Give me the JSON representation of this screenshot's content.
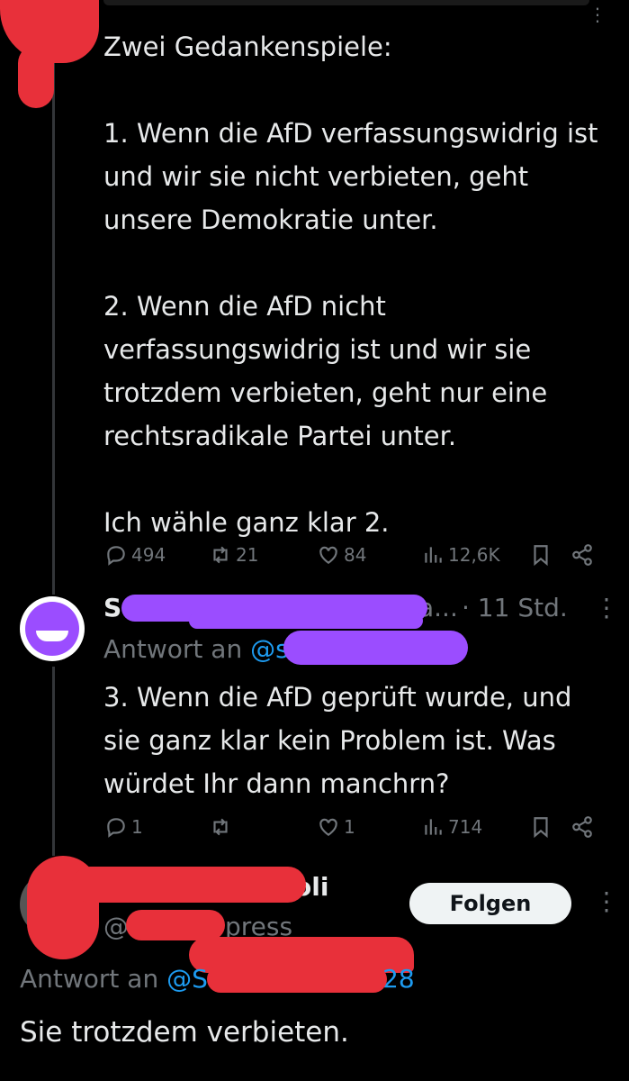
{
  "tweet1": {
    "text": "Zwei Gedankenspiele:\n\n1. Wenn die AfD verfassungswidrig ist und wir sie nicht verbieten, geht unsere Demokratie unter.\n\n2. Wenn die AfD nicht verfassungswidrig ist und wir sie trotzdem verbieten, geht nur eine rechtsradikale Partei unter.\n\nIch wähle ganz klar 2.",
    "replies": "494",
    "reposts": "21",
    "likes": "84",
    "views": "12,6K"
  },
  "tweet2": {
    "handle_prefix": "@S",
    "handle_suffix": "a...",
    "time": "· 11 Std.",
    "reply_to_label": "Antwort an",
    "reply_to_handle": "@s",
    "reply_to_handle_end": "s",
    "text": "3. Wenn die AfD geprüft wurde, und sie ganz klar kein Problem ist. Was würdet Ihr dann manchrn?",
    "replies": "1",
    "reposts": "",
    "likes": "1",
    "views": "714"
  },
  "tweet3": {
    "name_suffix": "oli",
    "handle": "@",
    "handle_suffix": "press",
    "follow_label": "Folgen",
    "reply_to_label": "Antwort an",
    "reply_to_handle": "@S",
    "reply_to_handle_end": "28",
    "text": "Sie trotzdem verbieten."
  },
  "icons": [
    "reply-icon",
    "repost-icon",
    "like-icon",
    "views-icon",
    "bookmark-icon",
    "share-icon",
    "more-icon"
  ],
  "colors": {
    "background": "#000000",
    "text": "#e7e9ea",
    "muted": "#71767b",
    "link": "#1d9bf0",
    "redaction_red": "#e8303a",
    "redaction_purple": "#9b4dff"
  }
}
